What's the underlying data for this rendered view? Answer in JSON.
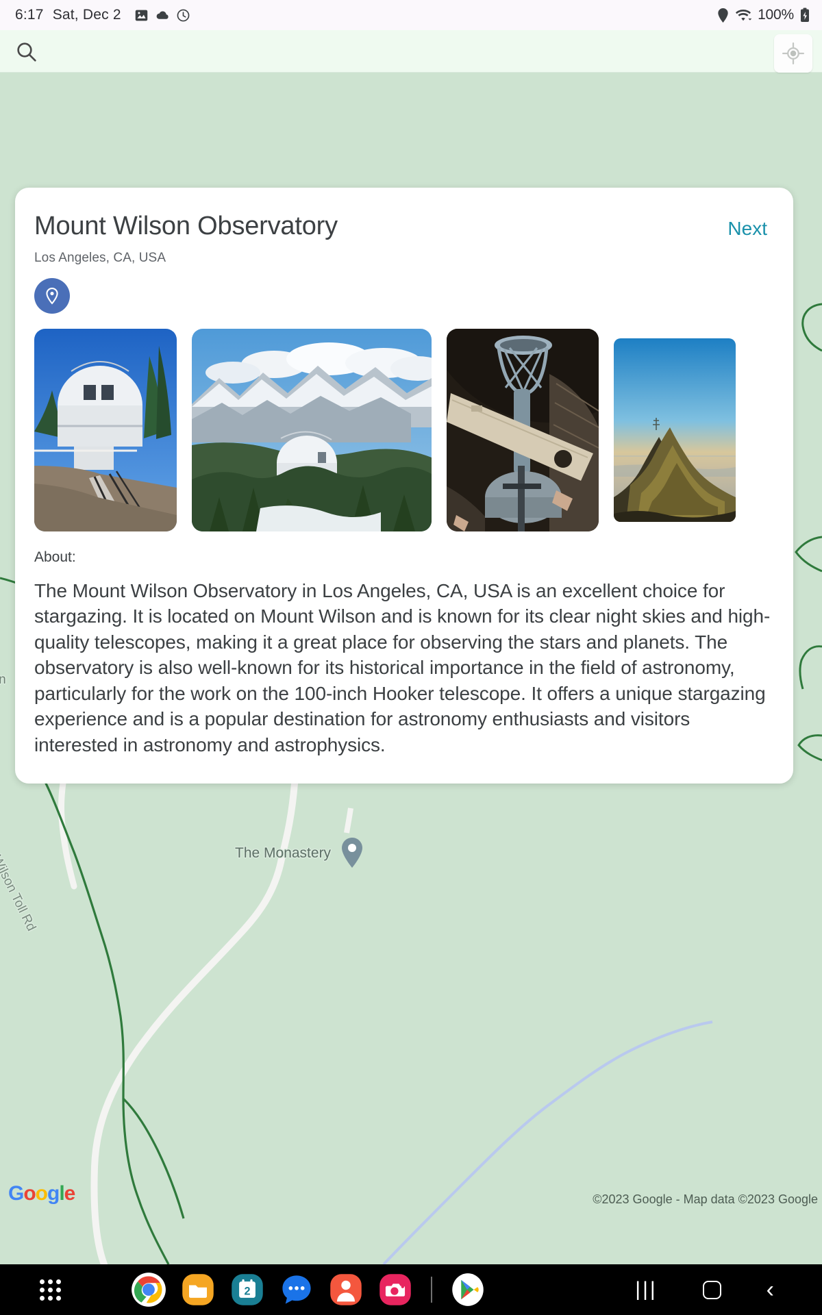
{
  "status_bar": {
    "time": "6:17",
    "date": "Sat, Dec 2",
    "battery": "100%",
    "icons": [
      "image-icon",
      "cloud-icon",
      "alarm-icon",
      "location-icon",
      "wifi-icon",
      "battery-charging-icon"
    ]
  },
  "search": {
    "icon": "search-icon",
    "placeholder": "",
    "value": ""
  },
  "map": {
    "my_location_icon": "my-location-icon",
    "labels": {
      "toll_road": "Mt Wilson Toll Rd",
      "clipped_label": "nsn",
      "monastery": "The Monastery"
    },
    "attribution": "©2023 Google - Map data ©2023 Google",
    "logo_letters": [
      "G",
      "o",
      "o",
      "g",
      "l",
      "e"
    ],
    "colors": {
      "land": "#cde3d0",
      "road": "#f2f2f0",
      "trail": "#2f7a3c"
    }
  },
  "card": {
    "title": "Mount Wilson Observatory",
    "subtitle": "Los Angeles, CA, USA",
    "next_label": "Next",
    "next_color": "#1a91ab",
    "pin_badge_color": "#4a6fb8",
    "pin_badge_icon": "location-pin-icon",
    "about_label": "About:",
    "about_text": "The Mount Wilson Observatory in Los Angeles, CA, USA is an excellent choice for stargazing. It is located on Mount Wilson and is known for its clear night skies and high-quality telescopes, making it a great place for observing the stars and planets. The observatory is also well-known for its historical importance in the field of astronomy, particularly for the work on the 100-inch Hooker telescope. It offers a unique stargazing experience and is a popular destination for astronomy enthusiasts and visitors interested in astronomy and astrophysics.",
    "photos": [
      {
        "caption": "White observatory dome with walkway under blue sky"
      },
      {
        "caption": "Observatory dome with snow-capped mountain range and clouds"
      },
      {
        "caption": "Interior of large Hooker telescope inside dome"
      },
      {
        "caption": "Mountain ridge at sunset overlooking valley haze"
      }
    ]
  },
  "taskbar": {
    "apps_button": "apps-grid-icon",
    "apps": [
      {
        "name": "chrome-icon",
        "label": "Chrome"
      },
      {
        "name": "files-icon",
        "label": "Files"
      },
      {
        "name": "calendar-icon",
        "label": "Calendar",
        "badge": "2"
      },
      {
        "name": "messages-icon",
        "label": "Messages"
      },
      {
        "name": "contacts-icon",
        "label": "Contacts"
      },
      {
        "name": "camera-icon",
        "label": "Camera"
      },
      {
        "name": "play-store-icon",
        "label": "Play Store"
      }
    ],
    "nav": {
      "recent": "|||",
      "home": "home-icon",
      "back": "‹"
    }
  }
}
